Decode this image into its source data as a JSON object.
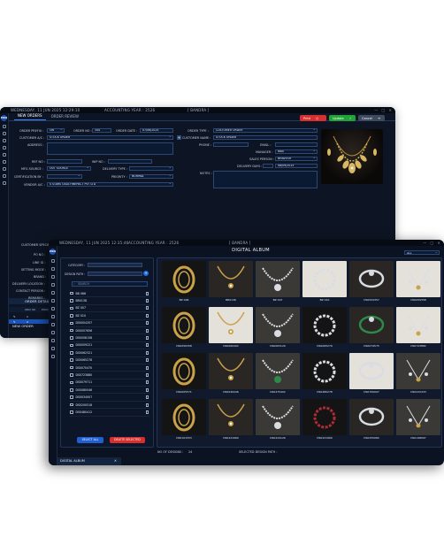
{
  "back_window": {
    "titlebar": {
      "datetime": "WEDNESDAY, 11 JUN 2025 12:29:10",
      "accounting_year": "ACCOUNTING YEAR : 2526",
      "branch": "[ BANDRA ]"
    },
    "tabs": [
      "NEW ORDERS",
      "ORDER REVIEW"
    ],
    "buttons": {
      "print": "Print",
      "update": "Update",
      "cancel": "Cancel"
    },
    "form": {
      "order_prefix_label": "ORDER PREFIX :",
      "order_prefix": "ON",
      "order_no_label": "ORDER NO :",
      "order_no": "344",
      "order_date_label": "ORDER DATE :",
      "order_date": "07/06/2025",
      "customer_ac_label": "CUSTOMER A/C :",
      "customer_ac": "STOCK ORDER",
      "address_label": "ADDRESS :",
      "ref_no_label": "REF NO :",
      "wip_no_label": "WIP NO :",
      "mfg_source_label": "MFG SOURCE :",
      "mfg_source": "OUT SOURCE",
      "delivery_type_label": "DELIVERY TYPE :",
      "certification_label": "CERTIFICATION BY :",
      "priority_label": "PRIORITY :",
      "priority": "NORMAL",
      "vendor_ac_label": "VENDOR A/C :",
      "vendor_ac": "S STARS GIGA FINEPACT PVT LTD",
      "order_type_label": "ORDER TYPE :",
      "order_type": "CUSTOMER ORDER",
      "customer_name_label": "CUSTOMER NAME :",
      "customer_name": "STOCK ORDER",
      "phone_label": "PHONE :",
      "email_label": "EMAIL :",
      "manager_label": "MANAGER :",
      "manager": "RAVI",
      "sales_person_label": "SALES PERSON :",
      "sales_person": "BHAVESH",
      "delivery_days_label": "DELIVERY DAYS :",
      "delivery_date": "08/09/2025",
      "notes_label": "NOTES :"
    },
    "order_details_title": "ORDER DETAILS",
    "columns": [
      "ORD SR.",
      "PRODUCT CODE",
      "ITEM CATEGORY",
      "MAKE",
      "METAL GROUP",
      "METAL TOLERANCE",
      "DIAMOND WEIGHT",
      "PURITY",
      "ORD QTY",
      "GOLD RATE",
      "ORDER BUDGET"
    ],
    "rows": [
      {
        "sr": "1",
        "category": "R G NECKLACE",
        "make": "HANDMADE",
        "metal": "GOLD",
        "tolerance": "0.000 - 0.000",
        "diamond": "0.000 - 0.000",
        "purity": "14.00",
        "qty": "1",
        "budget": "0.00 - 0.00"
      },
      {
        "sr": "2",
        "category": "R P GOLD JEWELLRY",
        "make": "HANDMADE",
        "metal": "GOLD",
        "tolerance": "0.000 - 0.000",
        "diamond": "0.000 - 0.000",
        "purity": "14.00",
        "qty": "1",
        "budget": "0.00 - 0.00"
      }
    ],
    "left_labels": [
      "CUSTOMER SPECIFI",
      "PO NO :",
      "LINE ID :",
      "SETTING MODE :",
      "BRAND :",
      "DELIVERY LOCATION :",
      "CONTACT PERSON :",
      "REMARKS :"
    ],
    "bottom_tab": "NEW ORDER"
  },
  "front_window": {
    "titlebar": {
      "datetime": "WEDNESDAY, 11 JUN 2025 12:35:46",
      "accounting_year": "ACCOUNTING YEAR : 2526",
      "branch": "[ BANDRA ]"
    },
    "title": "DIGITAL ALBUM",
    "album_select": "ALL",
    "category_label": "CATEGORY :",
    "design_path_label": "DESIGN PATH :",
    "search_placeholder": "SEARCH",
    "design_list": [
      "BB 066",
      "BR0138",
      "BZ 007",
      "BZ 010",
      "DS0054357",
      "DS0057656",
      "DS0058158",
      "DS0059221",
      "DS0062321",
      "DS0065278",
      "DS0070470",
      "DS0723880",
      "DS0079711",
      "DS0080046",
      "DS0034007",
      "DS0200518",
      "DS0480412"
    ],
    "select_all": "SELECT ALL",
    "delete_selected": "DELETE SELECTED",
    "gallery_rows": [
      [
        "BZ 006",
        "BR0136",
        "BZ 007",
        "BZ 010",
        "DS0054357",
        "DS0059358"
      ],
      [
        "DS0056358",
        "DS0060402",
        "DS0063120",
        "DS0065279",
        "DS0074575",
        "DS0723882"
      ],
      [
        "DS0005571",
        "DS0049446",
        "DS0475402",
        "DS0480278",
        "DS0700007",
        "DS0232433"
      ],
      [
        "DS0101553",
        "DS0221960",
        "DS0224126",
        "DS0221960",
        "DS0255082",
        "DS0148097"
      ]
    ],
    "footer": {
      "count_label": "NO OF DESIGNS :",
      "count": "24",
      "path_label": "SELECTED DESIGN PATH :"
    },
    "bottom_tab": "DIGITAL ALBUM"
  },
  "colors": {
    "bg_dark": "#0b1322",
    "accent_blue": "#1955b8",
    "print_red": "#d62f2f",
    "update_green": "#22a33a",
    "gold": "#c9a24a"
  }
}
